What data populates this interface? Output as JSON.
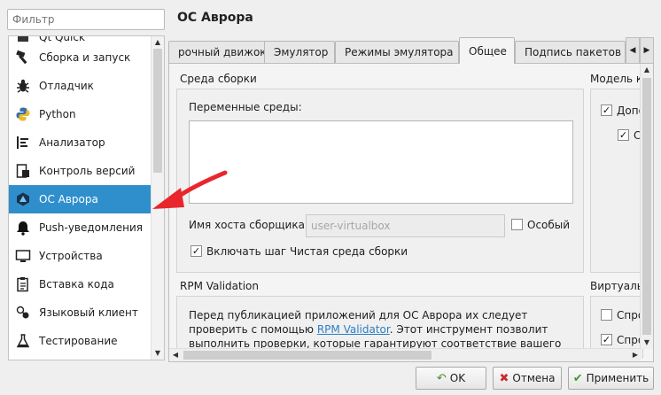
{
  "search": {
    "placeholder": "Фильтр"
  },
  "sidebar": {
    "items": [
      {
        "label": "Qt Quick",
        "icon": "qt-quick-icon",
        "partial": true
      },
      {
        "label": "Сборка и запуск",
        "icon": "hammer-icon"
      },
      {
        "label": "Отладчик",
        "icon": "bug-icon"
      },
      {
        "label": "Python",
        "icon": "python-icon"
      },
      {
        "label": "Анализатор",
        "icon": "analyzer-icon"
      },
      {
        "label": "Контроль версий",
        "icon": "version-control-icon"
      },
      {
        "label": "ОС Аврора",
        "icon": "aurora-icon",
        "selected": true
      },
      {
        "label": "Push-уведомления",
        "icon": "bell-icon"
      },
      {
        "label": "Устройства",
        "icon": "monitor-icon"
      },
      {
        "label": "Вставка кода",
        "icon": "snippet-icon"
      },
      {
        "label": "Языковый клиент",
        "icon": "language-client-icon"
      },
      {
        "label": "Тестирование",
        "icon": "flask-icon"
      }
    ]
  },
  "main": {
    "title": "ОС Аврора",
    "tabs": [
      {
        "label": "рочный движок"
      },
      {
        "label": "Эмулятор"
      },
      {
        "label": "Режимы эмулятора"
      },
      {
        "label": "Общее",
        "active": true
      },
      {
        "label": "Подпись пакетов"
      }
    ],
    "build_env": {
      "title": "Среда сборки",
      "env_vars_label": "Переменные среды:",
      "host_label": "Имя хоста сборщика:",
      "host_value": "user-virtualbox",
      "special_label": "Особый",
      "special_checked": false,
      "clean_step_label": "Включать шаг Чистая среда сборки",
      "clean_step_checked": true
    },
    "model_group": {
      "title": "Модель к",
      "opt1_label": "Допо",
      "opt1_checked": true,
      "opt2_label": "С",
      "opt2_checked": true
    },
    "rpm": {
      "title": "RPM Validation",
      "text_before": "Перед публикацией приложений для ОС Аврора их следует проверить с помощью ",
      "link": "RPM Validator",
      "text_after": ". Этот инструмент позволит выполнить проверки, которые гарантируют соответствие вашего приложения"
    },
    "virtual_group": {
      "title": "Виртуаль",
      "opt1_label": "Спро",
      "opt1_checked": false,
      "opt2_label": "Спро",
      "opt2_checked": true
    }
  },
  "buttons": {
    "ok": "OK",
    "cancel": "Отмена",
    "apply": "Применить"
  },
  "colors": {
    "selection": "#2f8fcc",
    "arrow": "#e8262b",
    "link": "#2a7fc4"
  }
}
